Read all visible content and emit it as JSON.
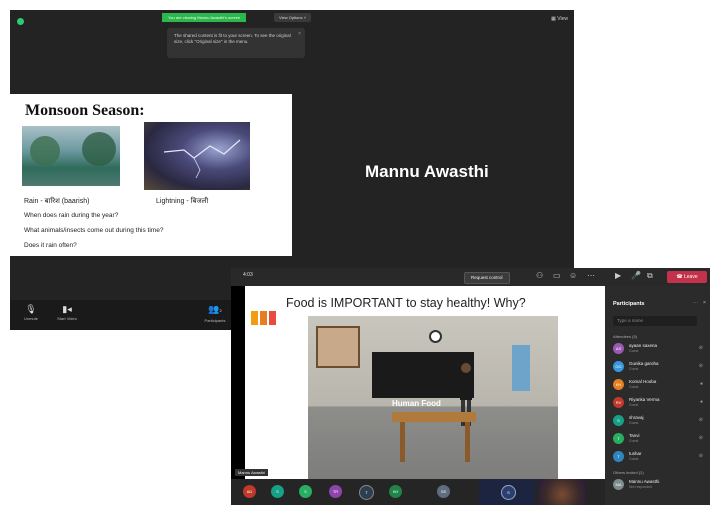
{
  "zoom": {
    "viewing_banner": "You are viewing Mannu Awasthi's screen",
    "view_options": "View Options ˅",
    "view_button": "View",
    "tip_text": "The shared content is fit to your screen. To see the original size, click \"Original size\" in the menu.",
    "presenter_name": "Mannu Awasthi",
    "toolbar": {
      "unmute": "Unmute",
      "start_video": "Start Video",
      "participants": "Participants",
      "participant_count": "2"
    },
    "slide": {
      "title": "Monsoon Season:",
      "label_rain": "Rain - बारिश (baarish)",
      "label_lightning": "Lightning - बिजली",
      "questions": [
        "When does rain during the year?",
        "What animals/insects come out during this time?",
        "Does it rain often?"
      ]
    }
  },
  "teams": {
    "time": "4:03",
    "request_control": "Request control",
    "leave": "Leave",
    "share": {
      "heading": "Food is IMPORTANT to stay healthy! Why?",
      "board_text": "Human Food",
      "presenter_tag": "Mannu Awasthi"
    },
    "avatar_bar": [
      "AD",
      "S",
      "S",
      "TR",
      "T",
      "KH",
      "SS",
      "S"
    ],
    "panel": {
      "title": "Participants",
      "search_placeholder": "Type a name",
      "attendees_label": "Attendees (5)",
      "others_label": "Others invited (2)",
      "attendees": [
        {
          "initials": "AS",
          "name": "ayaan saxena",
          "role": "Guest"
        },
        {
          "initials": "GG",
          "name": "Gunika garoha",
          "role": "Guest"
        },
        {
          "initials": "KH",
          "name": "Komal Hooba",
          "role": "Guest"
        },
        {
          "initials": "RV",
          "name": "Riyanka Verma",
          "role": "Guest"
        },
        {
          "initials": "S",
          "name": "shravaj",
          "role": "Guest"
        },
        {
          "initials": "T",
          "name": "Tanvi",
          "role": "Guest"
        },
        {
          "initials": "T",
          "name": "tushar",
          "role": "Guest"
        }
      ],
      "others": [
        {
          "initials": "MA",
          "name": "Mannu Awasthi",
          "role": "Not responded"
        }
      ]
    }
  }
}
